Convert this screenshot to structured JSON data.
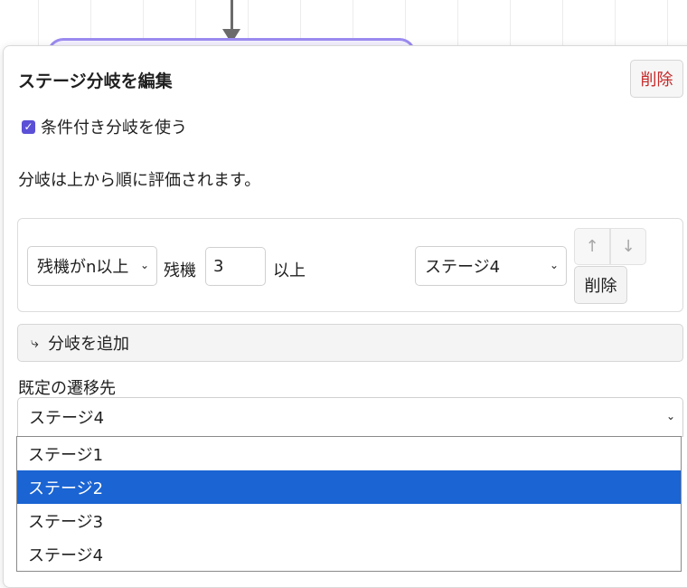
{
  "panel": {
    "title": "ステージ分岐を編集",
    "delete_label": "削除",
    "conditional_checkbox": {
      "checked": true,
      "label": "条件付き分岐を使う"
    },
    "description": "分岐は上から順に評価されます。"
  },
  "branches": [
    {
      "condition_select": "残機がn以上",
      "prefix_label": "残機",
      "value": "3",
      "suffix_label": "以上",
      "target_select": "ステージ4",
      "up_label": "↑",
      "down_label": "↓",
      "delete_label": "削除"
    }
  ],
  "add_branch": {
    "icon": "branch-add-icon",
    "label": "分岐を追加"
  },
  "default_target": {
    "label": "既定の遷移先",
    "selected": "ステージ4",
    "options": [
      "ステージ1",
      "ステージ2",
      "ステージ3",
      "ステージ4"
    ],
    "highlighted_option": "ステージ2"
  },
  "colors": {
    "accent": "#5b50d6",
    "danger": "#c62828",
    "highlight": "#1a64d3",
    "node_border": "#9b8bf0"
  }
}
